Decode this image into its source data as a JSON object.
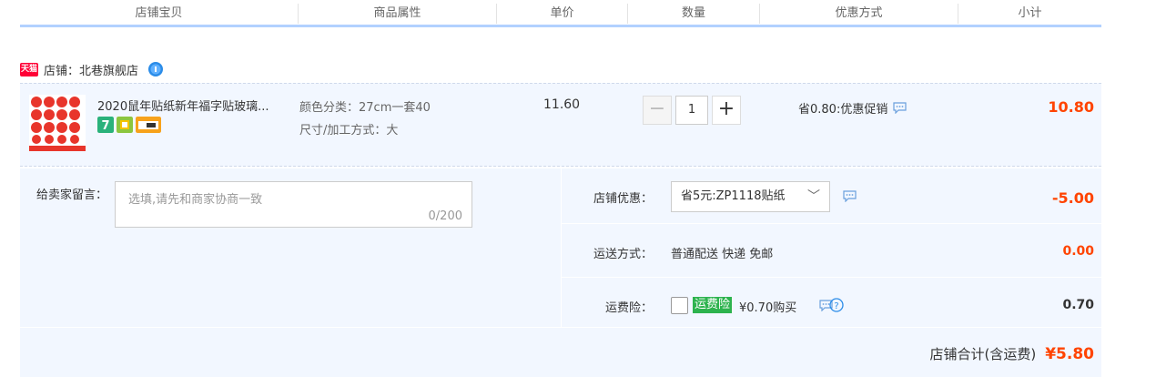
{
  "header": {
    "cols": [
      "店铺宝贝",
      "商品属性",
      "单价",
      "数量",
      "优惠方式",
      "小计"
    ]
  },
  "shop": {
    "badge": "天猫",
    "label": "店铺：北巷旗舰店"
  },
  "item": {
    "title": "2020鼠年贴纸新年福字贴玻璃...",
    "attr_color": "颜色分类：27cm一套40",
    "attr_size": "尺寸/加工方式：大",
    "price": "11.60",
    "quantity": "1",
    "qty_minus": "−",
    "qty_plus": "+",
    "promo": "省0.80:优惠促销",
    "subtotal": "10.80"
  },
  "message": {
    "label": "给卖家留言：",
    "placeholder": "选填,请先和商家协商一致",
    "counter": "0/200"
  },
  "shop_discount": {
    "label": "店铺优惠：",
    "selected": "省5元:ZP1118贴纸",
    "value": "-5.00"
  },
  "shipping": {
    "label": "运送方式：",
    "method": "普通配送 快递 免邮",
    "value": "0.00"
  },
  "insurance": {
    "label": "运费险：",
    "badge": "运费险",
    "text": "¥0.70购买",
    "value": "0.70"
  },
  "total": {
    "label": "店铺合计(含运费)",
    "value": "¥5.80"
  },
  "colors": {
    "accent_red": "#ff4400",
    "header_line": "#b2d1ff",
    "row_bg": "#f2f7ff",
    "insurance_green": "#2db34e"
  }
}
